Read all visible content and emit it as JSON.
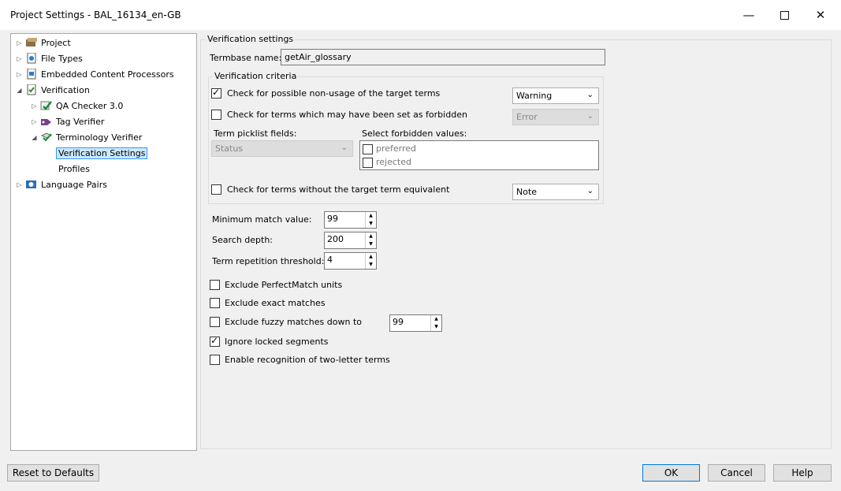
{
  "window": {
    "title": "Project Settings - BAL_16134_en-GB"
  },
  "tree": {
    "items": [
      {
        "label": "Project"
      },
      {
        "label": "File Types"
      },
      {
        "label": "Embedded Content Processors"
      },
      {
        "label": "Verification"
      },
      {
        "label": "QA Checker 3.0"
      },
      {
        "label": "Tag Verifier"
      },
      {
        "label": "Terminology Verifier"
      },
      {
        "label": "Verification Settings"
      },
      {
        "label": "Profiles"
      },
      {
        "label": "Language Pairs"
      }
    ]
  },
  "settings": {
    "group_title": "Verification settings",
    "termbase_label": "Termbase name:",
    "termbase_value": "getAir_glossary",
    "criteria_title": "Verification criteria",
    "non_usage_label": "Check for possible non-usage of the target terms",
    "non_usage_checked": true,
    "non_usage_severity": "Warning",
    "forbidden_label": "Check for terms which may have been set as forbidden",
    "forbidden_checked": false,
    "forbidden_severity": "Error",
    "picklist_label": "Term picklist fields:",
    "picklist_value": "Status",
    "forbidden_values_label": "Select forbidden values:",
    "forbidden_values": [
      {
        "label": "preferred",
        "checked": false
      },
      {
        "label": "rejected",
        "checked": false
      }
    ],
    "no_equivalent_label": "Check for terms without the target term equivalent",
    "no_equivalent_checked": false,
    "no_equivalent_severity": "Note",
    "min_match_label": "Minimum match value:",
    "min_match_value": "99",
    "search_depth_label": "Search depth:",
    "search_depth_value": "200",
    "repetition_label": "Term repetition threshold:",
    "repetition_value": "4",
    "exclude_perfect_label": "Exclude PerfectMatch units",
    "exclude_perfect_checked": false,
    "exclude_exact_label": "Exclude exact matches",
    "exclude_exact_checked": false,
    "exclude_fuzzy_label": "Exclude fuzzy matches down to",
    "exclude_fuzzy_checked": false,
    "exclude_fuzzy_value": "99",
    "ignore_locked_label": "Ignore locked segments",
    "ignore_locked_checked": true,
    "two_letter_label": "Enable recognition of two-letter terms",
    "two_letter_checked": false
  },
  "footer": {
    "reset_label": "Reset to Defaults",
    "ok_label": "OK",
    "cancel_label": "Cancel",
    "help_label": "Help"
  }
}
